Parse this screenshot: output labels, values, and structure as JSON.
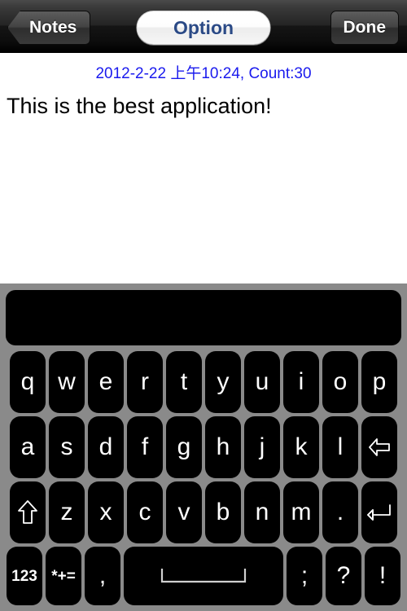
{
  "navbar": {
    "back_label": "Notes",
    "title_label": "Option",
    "done_label": "Done"
  },
  "note": {
    "meta": "2012-2-22 上午10:24, Count:30",
    "body": "This is the best application!",
    "meta_color": "#1a1aee",
    "body_color": "#000000"
  },
  "keyboard": {
    "background_color": "#8a8a8a",
    "key_color": "#000000",
    "key_text_color": "#ffffff",
    "candidate_bar": "",
    "rows": [
      {
        "name": "row-1",
        "keys": [
          {
            "label": "q",
            "name": "key-q"
          },
          {
            "label": "w",
            "name": "key-w"
          },
          {
            "label": "e",
            "name": "key-e"
          },
          {
            "label": "r",
            "name": "key-r"
          },
          {
            "label": "t",
            "name": "key-t"
          },
          {
            "label": "y",
            "name": "key-y"
          },
          {
            "label": "u",
            "name": "key-u"
          },
          {
            "label": "i",
            "name": "key-i"
          },
          {
            "label": "o",
            "name": "key-o"
          },
          {
            "label": "p",
            "name": "key-p"
          }
        ]
      },
      {
        "name": "row-2",
        "keys": [
          {
            "label": "a",
            "name": "key-a"
          },
          {
            "label": "s",
            "name": "key-s"
          },
          {
            "label": "d",
            "name": "key-d"
          },
          {
            "label": "f",
            "name": "key-f"
          },
          {
            "label": "g",
            "name": "key-g"
          },
          {
            "label": "h",
            "name": "key-h"
          },
          {
            "label": "j",
            "name": "key-j"
          },
          {
            "label": "k",
            "name": "key-k"
          },
          {
            "label": "l",
            "name": "key-l"
          },
          {
            "label": "",
            "name": "key-backspace",
            "icon": "backspace-icon"
          }
        ]
      },
      {
        "name": "row-3",
        "keys": [
          {
            "label": "",
            "name": "key-shift",
            "icon": "shift-icon"
          },
          {
            "label": "z",
            "name": "key-z"
          },
          {
            "label": "x",
            "name": "key-x"
          },
          {
            "label": "c",
            "name": "key-c"
          },
          {
            "label": "v",
            "name": "key-v"
          },
          {
            "label": "b",
            "name": "key-b"
          },
          {
            "label": "n",
            "name": "key-n"
          },
          {
            "label": "m",
            "name": "key-m"
          },
          {
            "label": ".",
            "name": "key-period"
          },
          {
            "label": "",
            "name": "key-return",
            "icon": "return-icon"
          }
        ]
      },
      {
        "name": "row-4",
        "keys": [
          {
            "label": "123",
            "name": "key-numbers"
          },
          {
            "label": "*+=",
            "name": "key-symbols"
          },
          {
            "label": ",",
            "name": "key-comma"
          },
          {
            "label": "",
            "name": "key-space",
            "icon": "space-icon"
          },
          {
            "label": ";",
            "name": "key-semicolon"
          },
          {
            "label": "?",
            "name": "key-question"
          },
          {
            "label": "!",
            "name": "key-exclamation"
          }
        ]
      }
    ]
  }
}
